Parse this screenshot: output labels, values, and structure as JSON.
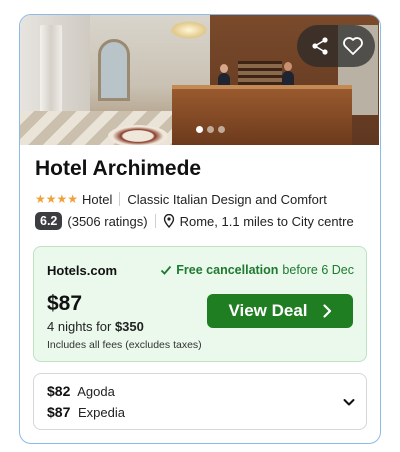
{
  "hotel": {
    "name": "Hotel Archimede",
    "stars": "★★★★",
    "type": "Hotel",
    "tagline": "Classic Italian Design and Comfort",
    "rating_score": "6.2",
    "rating_count": "(3506 ratings)",
    "location": "Rome, 1.1 miles to City centre"
  },
  "photo": {
    "dots_total": 3,
    "active_dot": 1,
    "icons": [
      "share-icon",
      "heart-icon"
    ]
  },
  "deal": {
    "provider": "Hotels.com",
    "cancellation_label": "Free cancellation",
    "cancellation_detail": "before 6 Dec",
    "price": "$87",
    "nights_text": "4 nights for",
    "total": "$350",
    "fees_note": "Includes all fees (excludes taxes)",
    "button_label": "View Deal"
  },
  "other_offers": [
    {
      "price": "$82",
      "provider": "Agoda"
    },
    {
      "price": "$87",
      "provider": "Expedia"
    }
  ],
  "colors": {
    "card_border": "#8bbbe6",
    "deal_bg": "#ebf8ec",
    "deal_button": "#1f7d22",
    "cancel_text": "#1d7a2f",
    "star": "#f0a23a",
    "score_badge": "#3b3d40"
  }
}
